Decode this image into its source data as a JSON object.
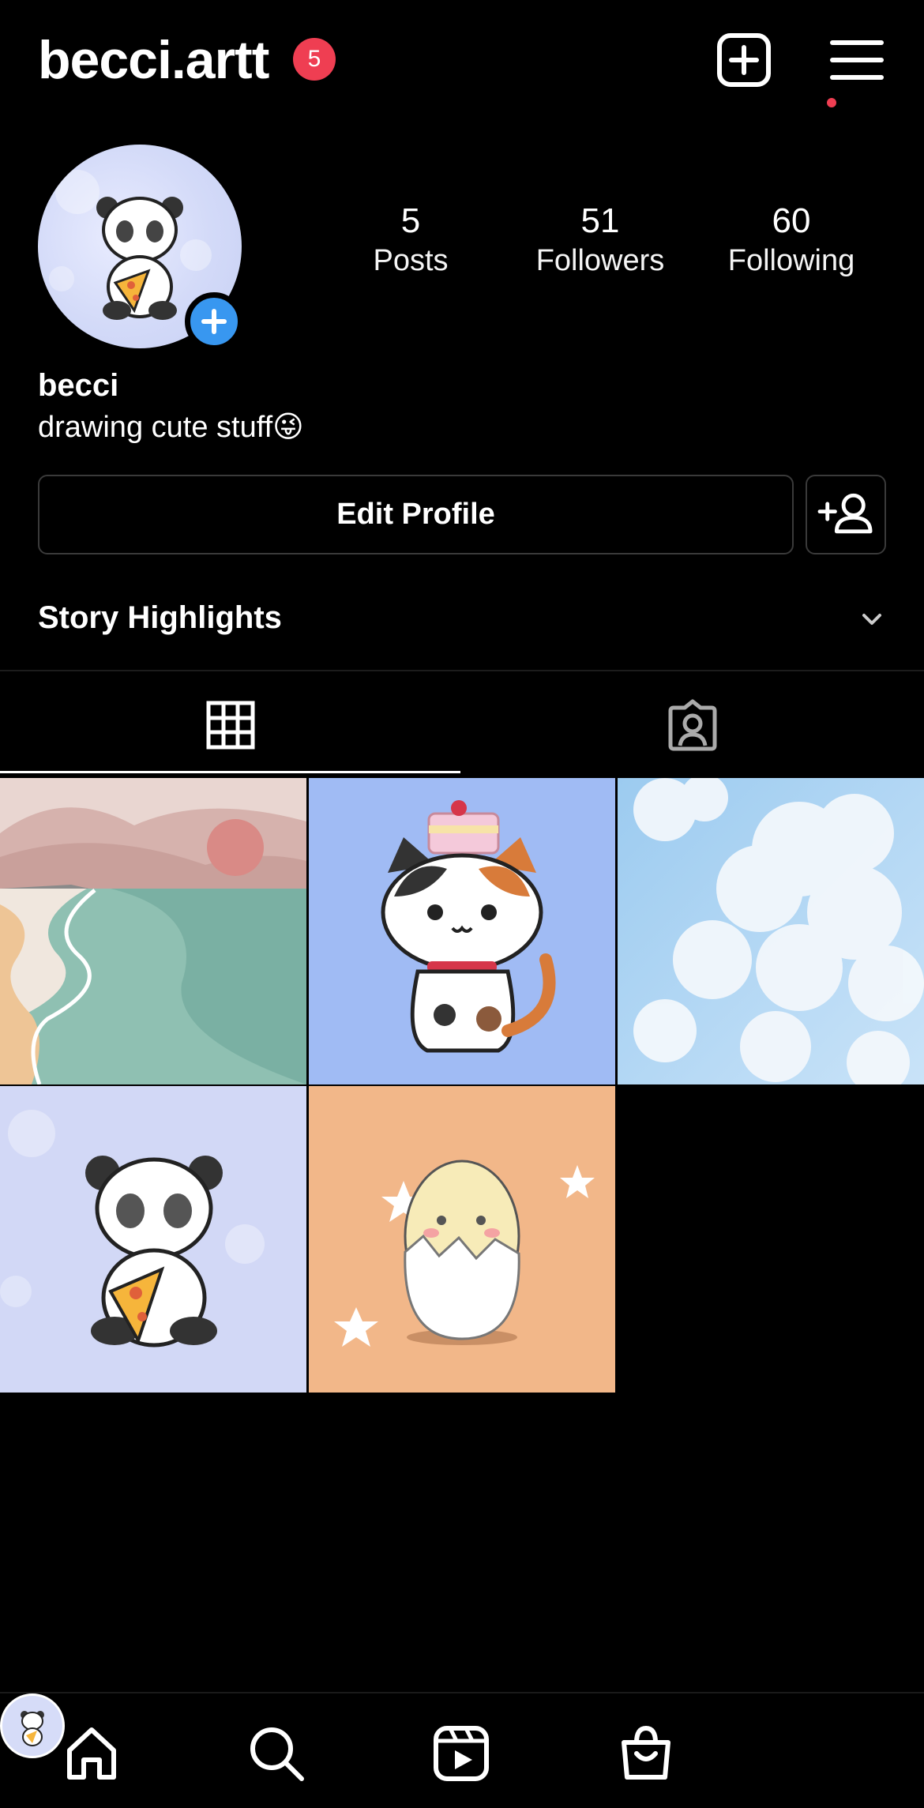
{
  "header": {
    "username": "becci.artt",
    "notification_count": "5",
    "icons": [
      "create-post-icon",
      "hamburger-menu-icon"
    ]
  },
  "profile": {
    "display_name": "becci",
    "bio": "drawing cute stuff😜",
    "stats": {
      "posts": {
        "value": "5",
        "label": "Posts"
      },
      "followers": {
        "value": "51",
        "label": "Followers"
      },
      "following": {
        "value": "60",
        "label": "Following"
      }
    },
    "edit_profile_label": "Edit Profile",
    "story_highlights_label": "Story Highlights"
  },
  "tabs": [
    {
      "name": "posts-grid",
      "icon": "grid-icon",
      "active": true
    },
    {
      "name": "tagged",
      "icon": "tagged-person-icon",
      "active": false
    }
  ],
  "posts": [
    {
      "subject": "beach landscape"
    },
    {
      "subject": "calico cat with cake"
    },
    {
      "subject": "clouds in blue sky"
    },
    {
      "subject": "panda eating pizza"
    },
    {
      "subject": "hatching egg with stars"
    }
  ],
  "bottom_nav": [
    {
      "icon": "home-icon"
    },
    {
      "icon": "search-icon"
    },
    {
      "icon": "reels-icon"
    },
    {
      "icon": "shop-icon"
    },
    {
      "icon": "profile-avatar"
    }
  ],
  "colors": {
    "background": "#000000",
    "badge_red": "#ef3e52",
    "accent_blue": "#3897f0",
    "border_gray": "#3a3a3a"
  }
}
